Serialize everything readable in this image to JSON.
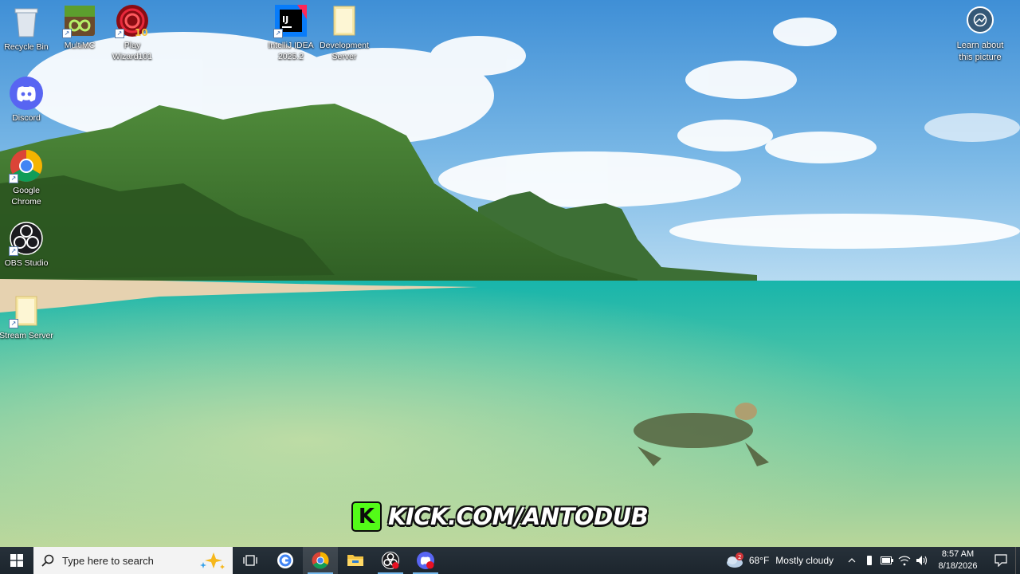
{
  "desktop": {
    "icons": [
      {
        "label": "Recycle Bin"
      },
      {
        "label": "MultiMC"
      },
      {
        "label": "Play\nWizard101"
      },
      {
        "label": "IntelliJ IDEA\n2025.2"
      },
      {
        "label": "Development\nServer"
      },
      {
        "label": "Discord"
      },
      {
        "label": "Google\nChrome"
      },
      {
        "label": "OBS Studio"
      },
      {
        "label": "Stream Server"
      }
    ],
    "learn_about": "Learn about\nthis picture"
  },
  "overlay": {
    "kick_text": "KICK.COM/ANTODUB",
    "kick_logo_letter": "K",
    "kick_color": "#53fc18"
  },
  "taskbar": {
    "search_placeholder": "Type here to search",
    "apps": [
      "task-view",
      "google-assistant",
      "google-chrome",
      "file-explorer",
      "obs-studio",
      "discord"
    ],
    "weather": {
      "badge": "2",
      "temp": "68°F",
      "condition": "Mostly cloudy"
    },
    "clock": {
      "time": "8:57 AM",
      "date": "8/18/2026"
    },
    "accent": "#76b9ed"
  }
}
